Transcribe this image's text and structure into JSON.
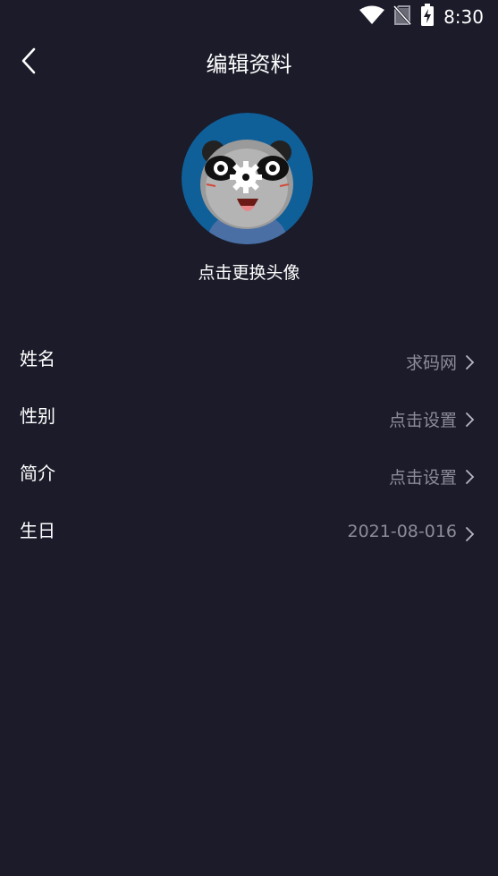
{
  "status_bar": {
    "time": "8:30",
    "icons": [
      "wifi-icon",
      "no-sim-icon",
      "battery-charging-icon"
    ]
  },
  "header": {
    "title": "编辑资料",
    "back_icon": "chevron-left-icon"
  },
  "avatar": {
    "caption": "点击更换头像",
    "overlay_icon": "gear-icon",
    "bg_color": "#0f5f99"
  },
  "profile_fields": [
    {
      "label": "姓名",
      "value": "求码网"
    },
    {
      "label": "性别",
      "value": "点击设置"
    },
    {
      "label": "简介",
      "value": "点击设置"
    },
    {
      "label": "生日",
      "value": "2021-08-016"
    }
  ],
  "colors": {
    "background": "#1b1b2a",
    "text_primary": "#ffffff",
    "text_secondary": "#8c8c99"
  }
}
